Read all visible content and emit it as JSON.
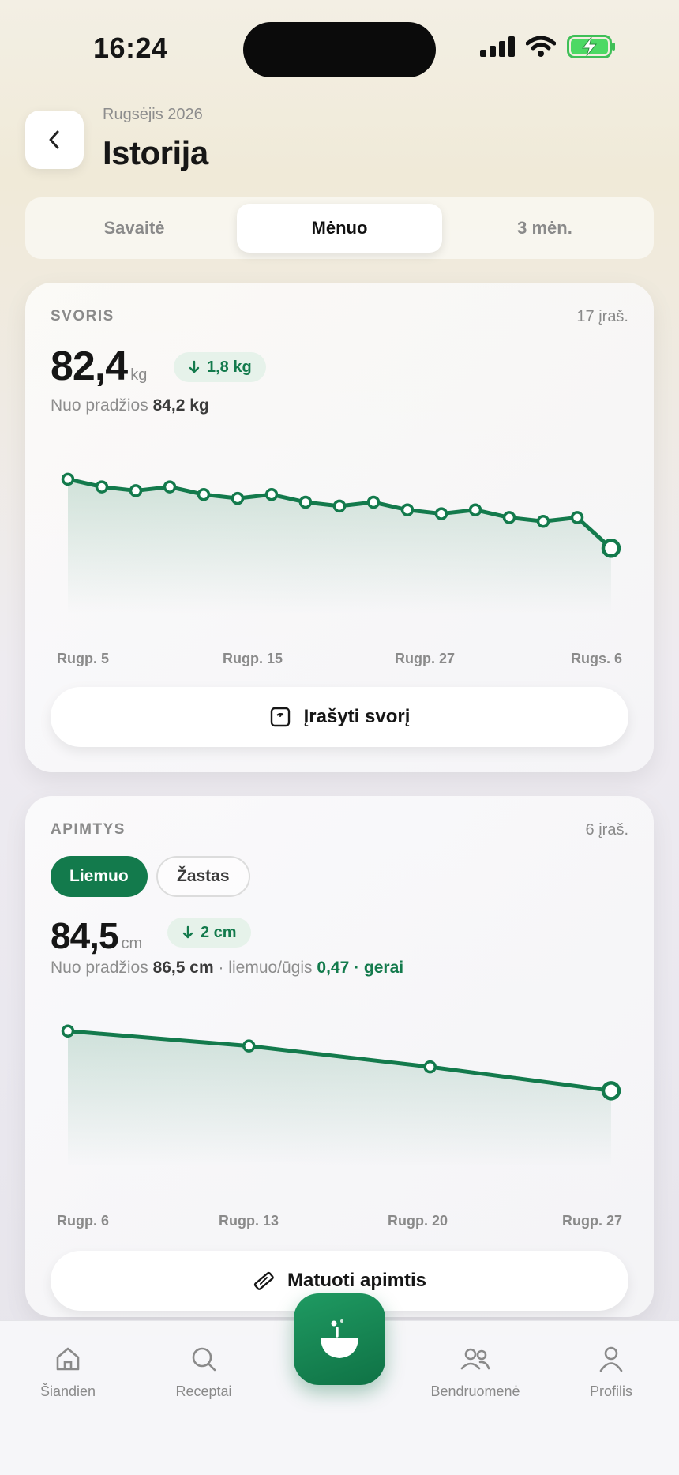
{
  "status_bar": {
    "time": "16:24"
  },
  "header": {
    "subtitle": "Rugsėjis 2026",
    "title": "Istorija"
  },
  "segments": [
    {
      "label": "Savaitė",
      "active": false
    },
    {
      "label": "Mėnuo",
      "active": true
    },
    {
      "label": "3 mėn.",
      "active": false
    }
  ],
  "weight": {
    "label": "SVORIS",
    "count": "17 įraš.",
    "value": "82,4",
    "unit": "kg",
    "delta": "1,8 kg",
    "since_prefix": "Nuo pradžios",
    "since_value": "84,2 kg",
    "button": "Įrašyti svorį",
    "x_labels": [
      "Rugp. 5",
      "Rugp. 15",
      "Rugp. 27",
      "Rugs. 6"
    ]
  },
  "girth": {
    "label": "APIMTYS",
    "count": "6 įraš.",
    "chips": [
      {
        "label": "Liemuo",
        "active": true
      },
      {
        "label": "Žastas",
        "active": false
      }
    ],
    "value": "84,5",
    "unit": "cm",
    "delta": "2 cm",
    "since_prefix": "Nuo pradžios",
    "since_value": "86,5 cm",
    "ratio_label": "· liemuo/ūgis",
    "ratio_value": "0,47 · gerai",
    "button": "Matuoti apimtis",
    "x_labels": [
      "Rugp. 6",
      "Rugp. 13",
      "Rugp. 20",
      "Rugp. 27"
    ]
  },
  "tabbar": {
    "items": [
      {
        "label": "Šiandien",
        "icon": "home-icon"
      },
      {
        "label": "Receptai",
        "icon": "search-icon"
      },
      {
        "label": "",
        "icon": "bowl-icon"
      },
      {
        "label": "Bendruomenė",
        "icon": "people-icon"
      },
      {
        "label": "Profilis",
        "icon": "profile-icon"
      }
    ]
  },
  "colors": {
    "accent": "#137a4c",
    "accent_light": "#e6f2ea"
  },
  "chart_data": [
    {
      "type": "line",
      "title": "SVORIS",
      "x": [
        "Rugp. 5",
        "",
        "",
        "",
        "",
        "",
        "",
        "",
        "",
        "",
        "",
        "",
        "",
        "",
        "",
        "",
        "Rugs. 6"
      ],
      "values": [
        84.2,
        84.0,
        83.9,
        84.0,
        83.8,
        83.7,
        83.8,
        83.6,
        83.5,
        83.6,
        83.4,
        83.3,
        83.4,
        83.2,
        83.1,
        83.2,
        82.4
      ],
      "ylim": [
        81.5,
        85.0
      ],
      "x_tick_labels": [
        "Rugp. 5",
        "Rugp. 15",
        "Rugp. 27",
        "Rugs. 6"
      ],
      "grid": false
    },
    {
      "type": "line",
      "title": "APIMTYS",
      "x": [
        "Rugp. 6",
        "Rugp. 13",
        "Rugp. 20",
        "Rugp. 27"
      ],
      "values": [
        86.5,
        86.0,
        85.3,
        84.5
      ],
      "ylim": [
        83.0,
        87.5
      ],
      "x_tick_labels": [
        "Rugp. 6",
        "Rugp. 13",
        "Rugp. 20",
        "Rugp. 27"
      ],
      "grid": false
    }
  ]
}
